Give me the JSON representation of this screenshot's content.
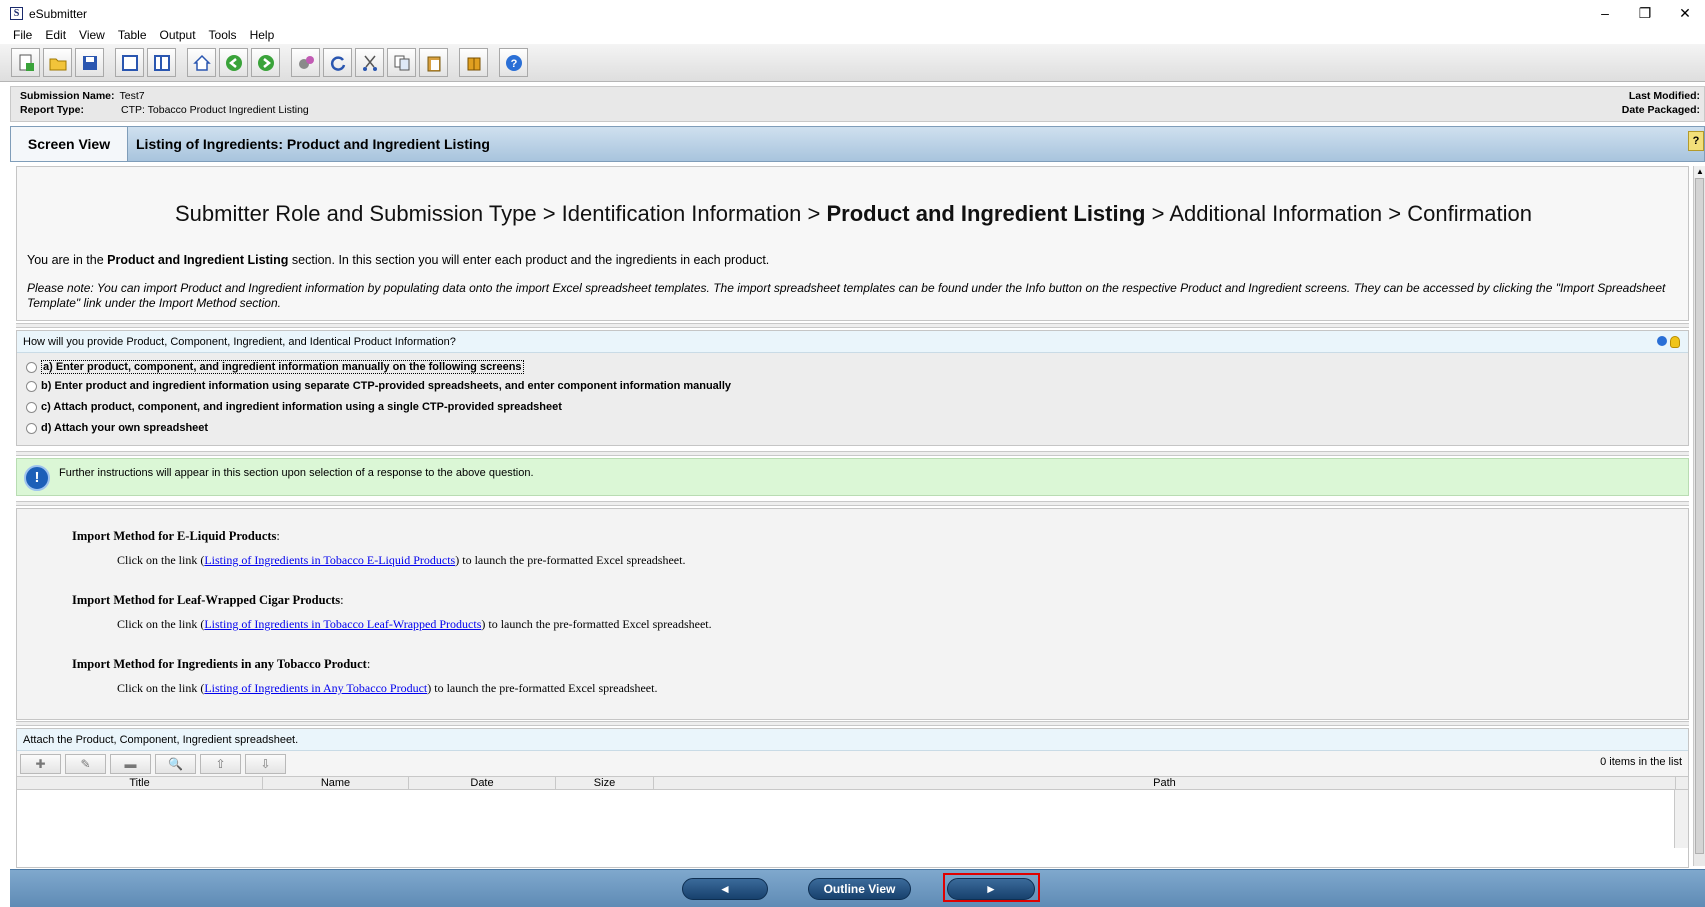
{
  "window": {
    "logo_letter": "S",
    "title": "eSubmitter",
    "controls": {
      "minimize": "–",
      "restore": "❐",
      "close": "✕"
    }
  },
  "menu": [
    {
      "label": "File"
    },
    {
      "label": "Edit"
    },
    {
      "label": "View"
    },
    {
      "label": "Table"
    },
    {
      "label": "Output"
    },
    {
      "label": "Tools"
    },
    {
      "label": "Help"
    }
  ],
  "toolbar": {
    "icons": [
      "new-file-icon",
      "open-folder-icon",
      "save-icon",
      "single-pane-icon",
      "split-pane-icon",
      "home-icon",
      "back-arrow-icon",
      "forward-arrow-icon",
      "gears-icon",
      "refresh-icon",
      "cut-icon",
      "copy-icon",
      "paste-icon",
      "package-icon",
      "help-icon"
    ]
  },
  "submission": {
    "name_label": "Submission Name:",
    "name_value": "Test7",
    "type_label": "Report Type:",
    "type_value": "CTP: Tobacco Product Ingredient Listing",
    "last_modified_label": "Last Modified:",
    "date_packaged_label": "Date Packaged:"
  },
  "screen": {
    "view_tab": "Screen View",
    "title": "Listing of Ingredients: Product and Ingredient Listing",
    "help_glyph": "?"
  },
  "breadcrumb": {
    "step1": "Submitter Role and Submission Type",
    "sep": ">",
    "step2": "Identification Information",
    "current": "Product and Ingredient Listing",
    "step4": "Additional Information",
    "step5": "Confirmation"
  },
  "intro": {
    "prefix": "You are in the ",
    "section": "Product and Ingredient Listing",
    "suffix": " section. In this section you will enter each product and the ingredients in each product."
  },
  "note": "Please note: You can import Product and Ingredient information by populating data onto the import Excel spreadsheet templates. The import spreadsheet templates can be found under the Info button on the respective Product and Ingredient screens. They can be accessed by clicking the \"Import Spreadsheet Template\" link under the Import Method section.",
  "question": {
    "text": "How will you provide Product, Component, Ingredient, and Identical Product Information?",
    "options": [
      {
        "label": "a) Enter product, component, and ingredient information manually on the following screens"
      },
      {
        "label": "b) Enter product and ingredient information using separate CTP-provided spreadsheets, and enter component information manually"
      },
      {
        "label": "c) Attach product, component, and ingredient information using a single CTP-provided spreadsheet"
      },
      {
        "label": "d) Attach your own spreadsheet"
      }
    ]
  },
  "info": {
    "glyph": "!",
    "text": "Further instructions will appear in this section upon selection of a response to the above question."
  },
  "import_methods": [
    {
      "title": "Import Method for E-Liquid Products",
      "colon": ":",
      "prefix": "Click on the link (",
      "link": "Listing of Ingredients in Tobacco E-Liquid Products",
      "suffix": ") to launch the pre-formatted Excel spreadsheet."
    },
    {
      "title": "Import Method for Leaf-Wrapped Cigar Products",
      "colon": ":",
      "prefix": "Click on the link (",
      "link": "Listing of Ingredients in Tobacco Leaf-Wrapped Products",
      "suffix": ") to launch the pre-formatted Excel spreadsheet."
    },
    {
      "title": "Import Method for Ingredients in any Tobacco Product",
      "colon": ":",
      "prefix": "Click on the link (",
      "link": "Listing of Ingredients in Any Tobacco Product",
      "suffix": ") to launch the pre-formatted Excel spreadsheet."
    }
  ],
  "attach": {
    "heading": "Attach the Product, Component, Ingredient spreadsheet.",
    "tools": {
      "add": "✚",
      "edit": "✎",
      "remove": "▬",
      "view": "🔍",
      "up": "⇧",
      "down": "⇩"
    },
    "count": "0 items in the list",
    "columns": [
      "Title",
      "Name",
      "Date",
      "Size",
      "Path"
    ]
  },
  "nav": {
    "back": "◄",
    "outline": "Outline View",
    "next": "►"
  }
}
